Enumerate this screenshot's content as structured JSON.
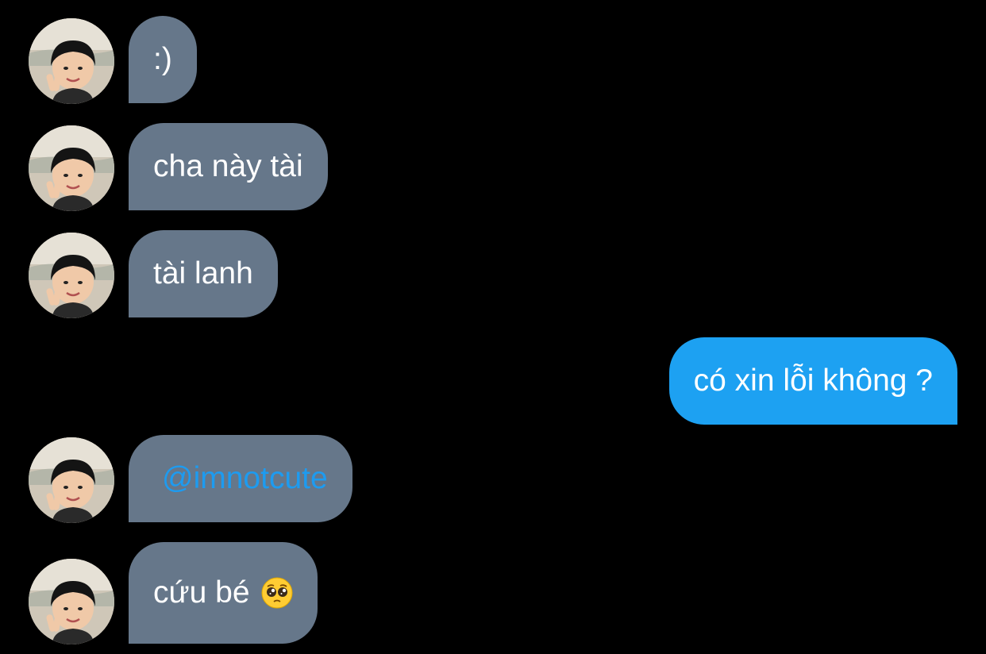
{
  "messages": [
    {
      "side": "in",
      "text": ":)"
    },
    {
      "side": "in",
      "text": "cha này tài"
    },
    {
      "side": "in",
      "text": "tài lanh"
    },
    {
      "side": "out",
      "text": "có xin lỗi không ?"
    },
    {
      "side": "in",
      "text": "@imnotcute"
    },
    {
      "side": "in",
      "text": "cứu bé",
      "emoji": "pleading-face-emoji"
    }
  ],
  "colors": {
    "background": "#000000",
    "incoming_bubble": "#66778a",
    "outgoing_bubble": "#1da1f2",
    "mention_link": "#1d9bf0",
    "text": "#ffffff"
  },
  "icons": {
    "avatar": "child-photo-avatar",
    "emoji": "pleading-face-emoji"
  }
}
